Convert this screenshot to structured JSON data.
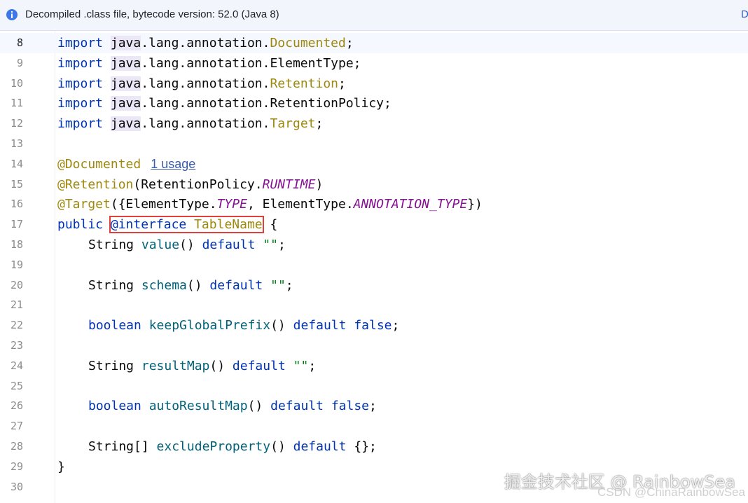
{
  "banner": {
    "message": "Decompiled .class file, bytecode version: 52.0 (Java 8)",
    "edge_text": "D",
    "icon": "info-icon"
  },
  "lines": [
    {
      "n": "8",
      "tokens": [
        [
          "kw",
          "import"
        ],
        [
          "t",
          " "
        ],
        [
          "jv",
          "java"
        ],
        [
          "t",
          ".lang.annotation."
        ],
        [
          "cls",
          "Documented"
        ],
        [
          "t",
          ";"
        ]
      ]
    },
    {
      "n": "9",
      "tokens": [
        [
          "kw",
          "import"
        ],
        [
          "t",
          " "
        ],
        [
          "jv",
          "java"
        ],
        [
          "t",
          ".lang.annotation.ElementType;"
        ]
      ]
    },
    {
      "n": "10",
      "tokens": [
        [
          "kw",
          "import"
        ],
        [
          "t",
          " "
        ],
        [
          "jv",
          "java"
        ],
        [
          "t",
          ".lang.annotation."
        ],
        [
          "cls",
          "Retention"
        ],
        [
          "t",
          ";"
        ]
      ]
    },
    {
      "n": "11",
      "tokens": [
        [
          "kw",
          "import"
        ],
        [
          "t",
          " "
        ],
        [
          "jv",
          "java"
        ],
        [
          "t",
          ".lang.annotation.RetentionPolicy;"
        ]
      ]
    },
    {
      "n": "12",
      "tokens": [
        [
          "kw",
          "import"
        ],
        [
          "t",
          " "
        ],
        [
          "jv",
          "java"
        ],
        [
          "t",
          ".lang.annotation."
        ],
        [
          "cls",
          "Target"
        ],
        [
          "t",
          ";"
        ]
      ]
    },
    {
      "n": "13",
      "tokens": []
    },
    {
      "n": "14",
      "tokens": [
        [
          "ann",
          "@Documented"
        ],
        [
          "usage",
          "1 usage"
        ]
      ]
    },
    {
      "n": "15",
      "tokens": [
        [
          "ann",
          "@Retention"
        ],
        [
          "t",
          "(RetentionPolicy."
        ],
        [
          "cst",
          "RUNTIME"
        ],
        [
          "t",
          ")"
        ]
      ]
    },
    {
      "n": "16",
      "tokens": [
        [
          "ann",
          "@Target"
        ],
        [
          "t",
          "({ElementType."
        ],
        [
          "cst",
          "TYPE"
        ],
        [
          "t",
          ", ElementType."
        ],
        [
          "cst",
          "ANNOTATION_TYPE"
        ],
        [
          "t",
          "})"
        ]
      ]
    },
    {
      "n": "17",
      "tokens": [
        [
          "kw",
          "public"
        ],
        [
          "t",
          " "
        ],
        [
          "hl_start",
          ""
        ],
        [
          "kw",
          "@interface"
        ],
        [
          "t",
          " "
        ],
        [
          "cls",
          "TableName"
        ],
        [
          "hl_end",
          ""
        ],
        [
          "t",
          " {"
        ]
      ]
    },
    {
      "n": "18",
      "tokens": [
        [
          "ind",
          ""
        ],
        [
          "t",
          "String "
        ],
        [
          "mth",
          "value"
        ],
        [
          "t",
          "() "
        ],
        [
          "kw",
          "default"
        ],
        [
          "t",
          " "
        ],
        [
          "str",
          "\"\""
        ],
        [
          "t",
          ";"
        ]
      ]
    },
    {
      "n": "19",
      "tokens": []
    },
    {
      "n": "20",
      "tokens": [
        [
          "ind",
          ""
        ],
        [
          "t",
          "String "
        ],
        [
          "mth",
          "schema"
        ],
        [
          "t",
          "() "
        ],
        [
          "kw",
          "default"
        ],
        [
          "t",
          " "
        ],
        [
          "str",
          "\"\""
        ],
        [
          "t",
          ";"
        ]
      ]
    },
    {
      "n": "21",
      "tokens": []
    },
    {
      "n": "22",
      "tokens": [
        [
          "ind",
          ""
        ],
        [
          "kw",
          "boolean"
        ],
        [
          "t",
          " "
        ],
        [
          "mth",
          "keepGlobalPrefix"
        ],
        [
          "t",
          "() "
        ],
        [
          "kw",
          "default"
        ],
        [
          "t",
          " "
        ],
        [
          "kw",
          "false"
        ],
        [
          "t",
          ";"
        ]
      ]
    },
    {
      "n": "23",
      "tokens": []
    },
    {
      "n": "24",
      "tokens": [
        [
          "ind",
          ""
        ],
        [
          "t",
          "String "
        ],
        [
          "mth",
          "resultMap"
        ],
        [
          "t",
          "() "
        ],
        [
          "kw",
          "default"
        ],
        [
          "t",
          " "
        ],
        [
          "str",
          "\"\""
        ],
        [
          "t",
          ";"
        ]
      ]
    },
    {
      "n": "25",
      "tokens": []
    },
    {
      "n": "26",
      "tokens": [
        [
          "ind",
          ""
        ],
        [
          "kw",
          "boolean"
        ],
        [
          "t",
          " "
        ],
        [
          "mth",
          "autoResultMap"
        ],
        [
          "t",
          "() "
        ],
        [
          "kw",
          "default"
        ],
        [
          "t",
          " "
        ],
        [
          "kw",
          "false"
        ],
        [
          "t",
          ";"
        ]
      ]
    },
    {
      "n": "27",
      "tokens": []
    },
    {
      "n": "28",
      "tokens": [
        [
          "ind",
          ""
        ],
        [
          "t",
          "String[] "
        ],
        [
          "mth",
          "excludeProperty"
        ],
        [
          "t",
          "() "
        ],
        [
          "kw",
          "default"
        ],
        [
          "t",
          " {};"
        ]
      ]
    },
    {
      "n": "29",
      "tokens": [
        [
          "t",
          "}"
        ]
      ]
    },
    {
      "n": "30",
      "tokens": []
    }
  ],
  "current_line": "8",
  "watermark": {
    "main": "掘金技术社区 @ RainbowSea",
    "sub": "CSDN @ChinaRainbowSea"
  }
}
